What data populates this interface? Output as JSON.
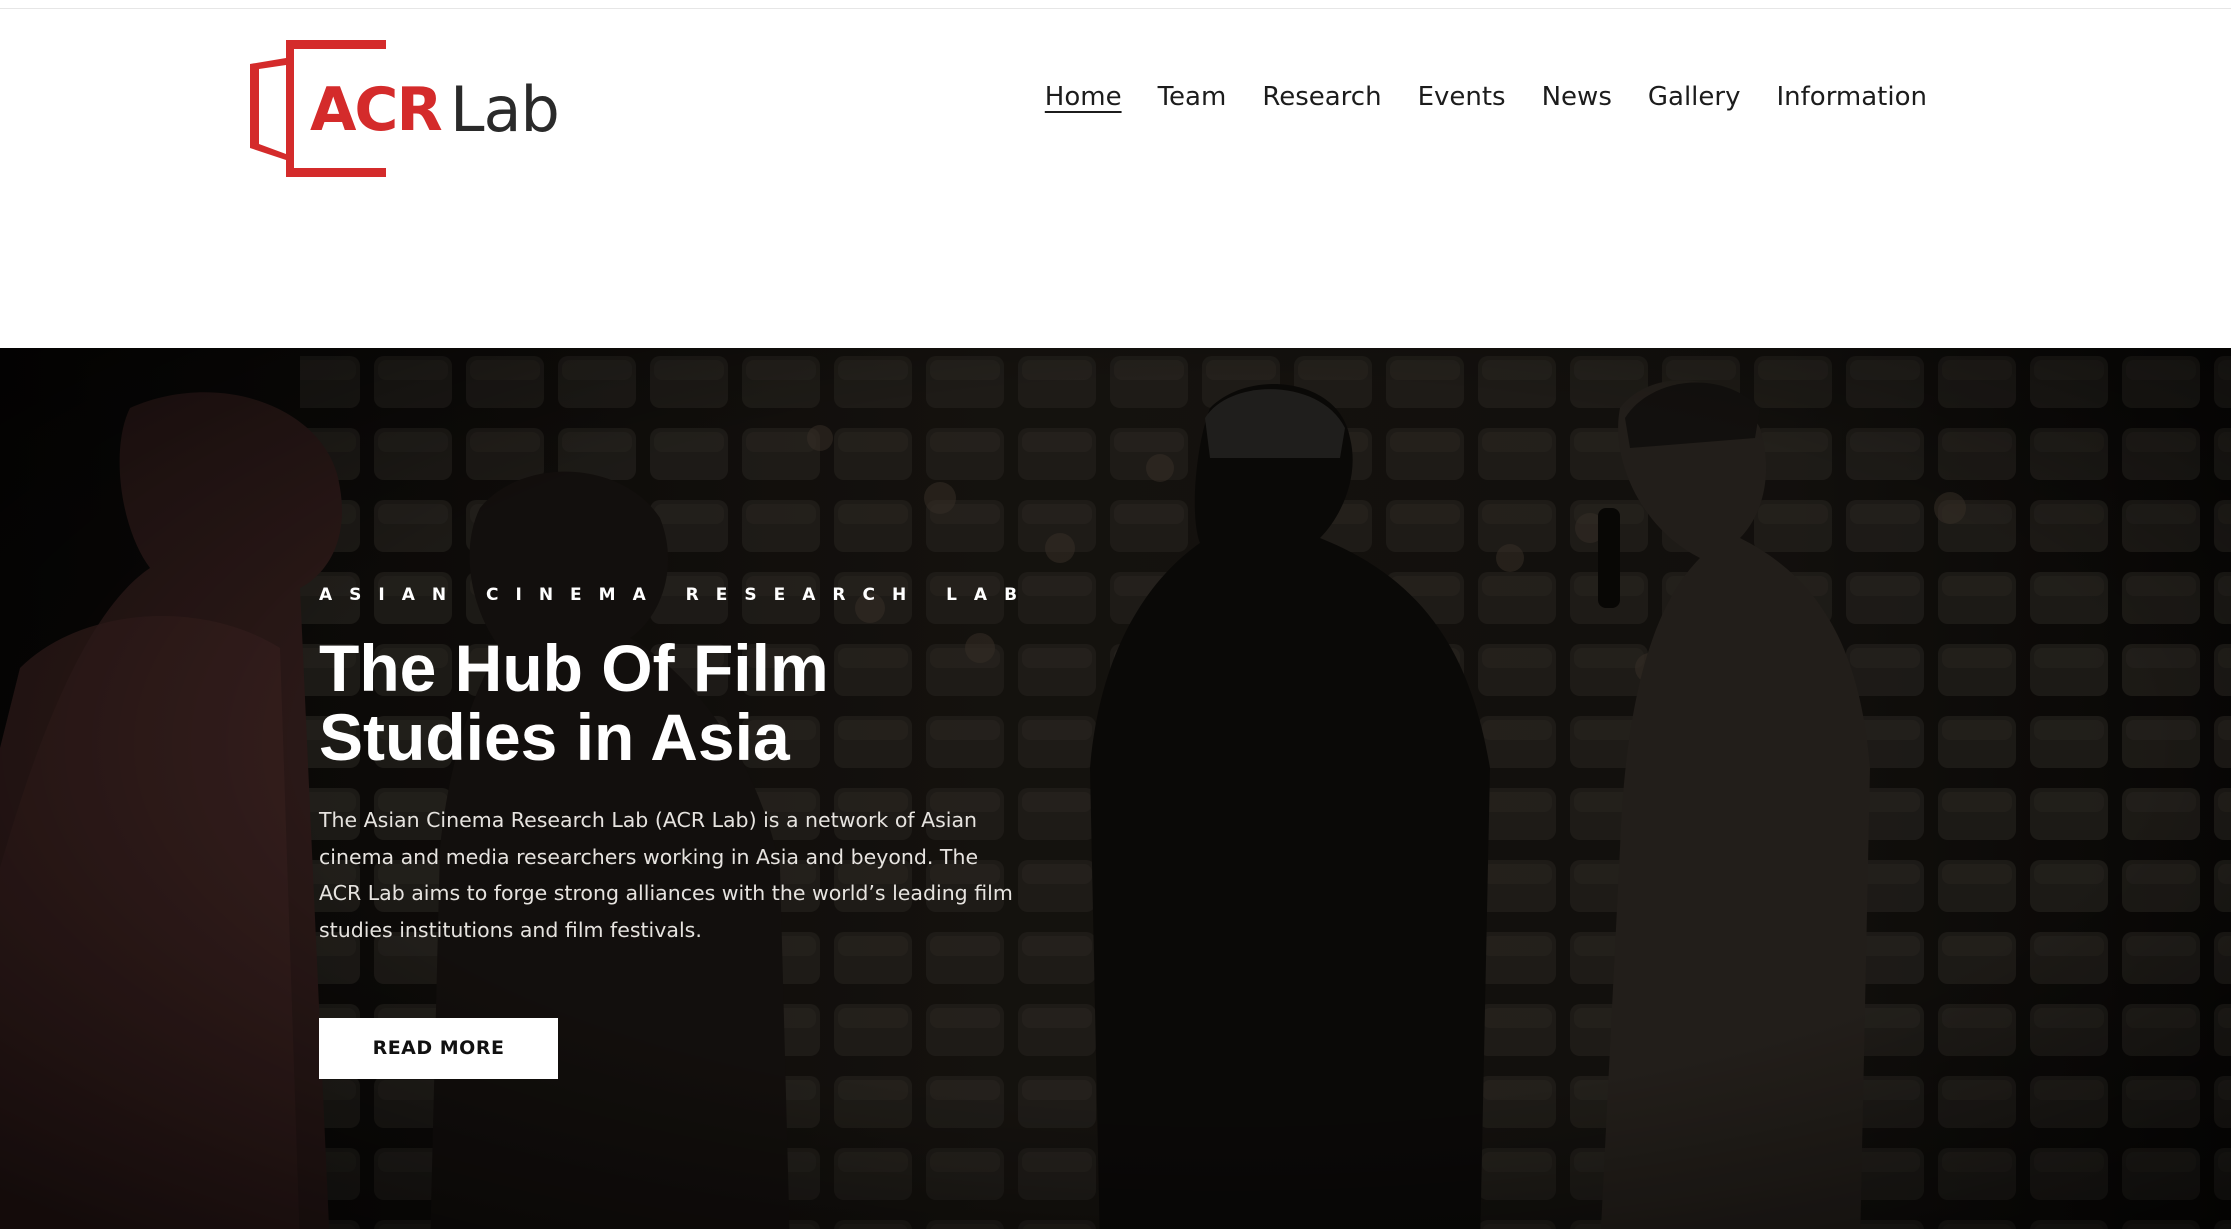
{
  "logo": {
    "acr": "ACR",
    "lab": "Lab"
  },
  "nav": {
    "items": [
      {
        "label": "Home",
        "active": true
      },
      {
        "label": "Team"
      },
      {
        "label": "Research"
      },
      {
        "label": "Events"
      },
      {
        "label": "News"
      },
      {
        "label": "Gallery"
      },
      {
        "label": "Information"
      }
    ]
  },
  "hero": {
    "eyebrow": "ASIAN CINEMA RESEARCH LAB",
    "title_line1": "The Hub Of Film",
    "title_line2": "Studies in Asia",
    "description": "The Asian Cinema Research Lab (ACR Lab) is a network of Asian cinema and media researchers working in Asia and beyond. The ACR Lab aims to forge strong alliances with the world’s leading film studies institutions and film festivals.",
    "button_label": "READ MORE"
  },
  "colors": {
    "brand_red": "#d42b2b",
    "hero_overlay": "#0d0b09",
    "nav_text": "#1c1c1c"
  }
}
